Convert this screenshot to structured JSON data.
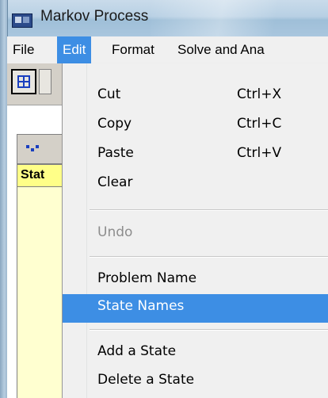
{
  "window": {
    "title": "Markov Process"
  },
  "menubar": {
    "items": [
      "File",
      "Edit",
      "Format",
      "Solve and Ana"
    ],
    "active_index": 1
  },
  "sheet": {
    "row_header": "Stat"
  },
  "edit_menu": {
    "items": [
      {
        "label": "Cut",
        "shortcut": "Ctrl+X",
        "enabled": true
      },
      {
        "label": "Copy",
        "shortcut": "Ctrl+C",
        "enabled": true
      },
      {
        "label": "Paste",
        "shortcut": "Ctrl+V",
        "enabled": true
      },
      {
        "label": "Clear",
        "shortcut": "",
        "enabled": true
      },
      {
        "label": "Undo",
        "shortcut": "",
        "enabled": false
      },
      {
        "label": "Problem Name",
        "shortcut": "",
        "enabled": true
      },
      {
        "label": "State Names",
        "shortcut": "",
        "enabled": true,
        "highlighted": true
      },
      {
        "label": "Add a State",
        "shortcut": "",
        "enabled": true
      },
      {
        "label": "Delete a State",
        "shortcut": "",
        "enabled": true
      }
    ]
  },
  "icons": {
    "app": "app-window-icon",
    "toolbar_grid": "grid-icon",
    "sheet_corner": "sheet-corner-icon"
  },
  "colors": {
    "highlight": "#3d8ee4",
    "row_header_bg": "#ffff88"
  }
}
